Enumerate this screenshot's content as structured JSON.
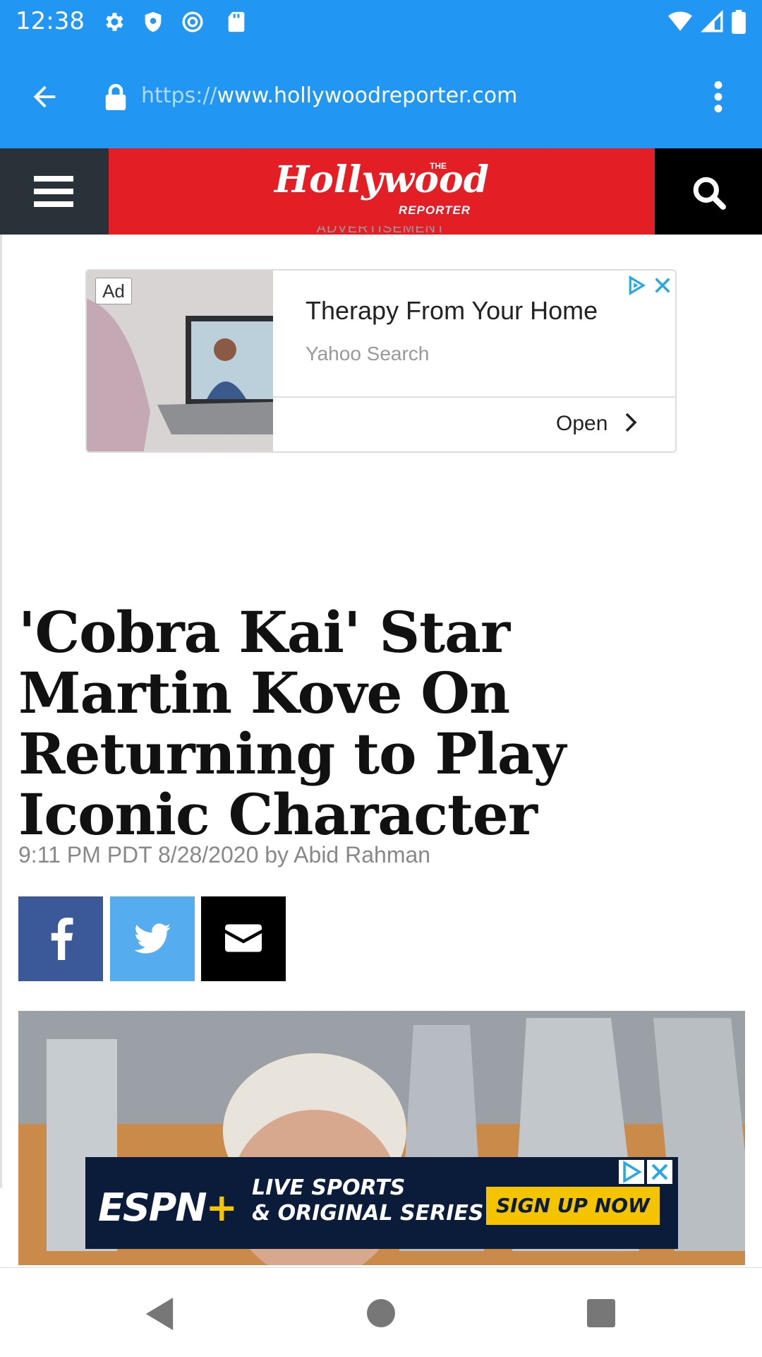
{
  "status_bar": {
    "time": "12:38",
    "left_icons": [
      "gear-icon",
      "shield-icon",
      "at-sign-icon",
      "sd-card-icon"
    ],
    "right_icons": [
      "wifi-icon",
      "signal-icon",
      "battery-icon"
    ]
  },
  "browser": {
    "url_protocol": "https://",
    "url_host": "www.hollywoodreporter.com",
    "icons": [
      "back-arrow-icon",
      "lock-icon",
      "more-vertical-icon"
    ],
    "accent_color": "#2196f3"
  },
  "site_header": {
    "logo_main": "Hollywood",
    "logo_the": "THE",
    "logo_reporter": "REPORTER",
    "brand_color": "#e31e25",
    "icons": [
      "hamburger-menu-icon",
      "search-icon"
    ]
  },
  "ad_label": "ADVERTISEMENT",
  "ad": {
    "badge": "Ad",
    "title": "Therapy From Your Home",
    "source": "Yahoo Search",
    "cta": "Open",
    "icons": [
      "adchoices-icon",
      "close-icon",
      "chevron-right-icon"
    ]
  },
  "article": {
    "headline": "'Cobra Kai' Star Martin Kove On Returning to Play Iconic Character",
    "byline": "9:11 PM PDT 8/28/2020 by Abid Rahman",
    "share": [
      {
        "icon": "facebook-icon",
        "color": "#3b5998"
      },
      {
        "icon": "twitter-icon",
        "color": "#55acee"
      },
      {
        "icon": "email-icon",
        "color": "#000000"
      }
    ]
  },
  "banner_ad": {
    "brand": "ESPN",
    "brand_plus": "+",
    "line1": "LIVE SPORTS",
    "line2": "& ORIGINAL SERIES",
    "cta": "SIGN UP NOW",
    "icons": [
      "adchoices-icon",
      "close-icon"
    ]
  },
  "nav_bar": {
    "icons": [
      "back-triangle-icon",
      "home-circle-icon",
      "recents-square-icon"
    ]
  }
}
